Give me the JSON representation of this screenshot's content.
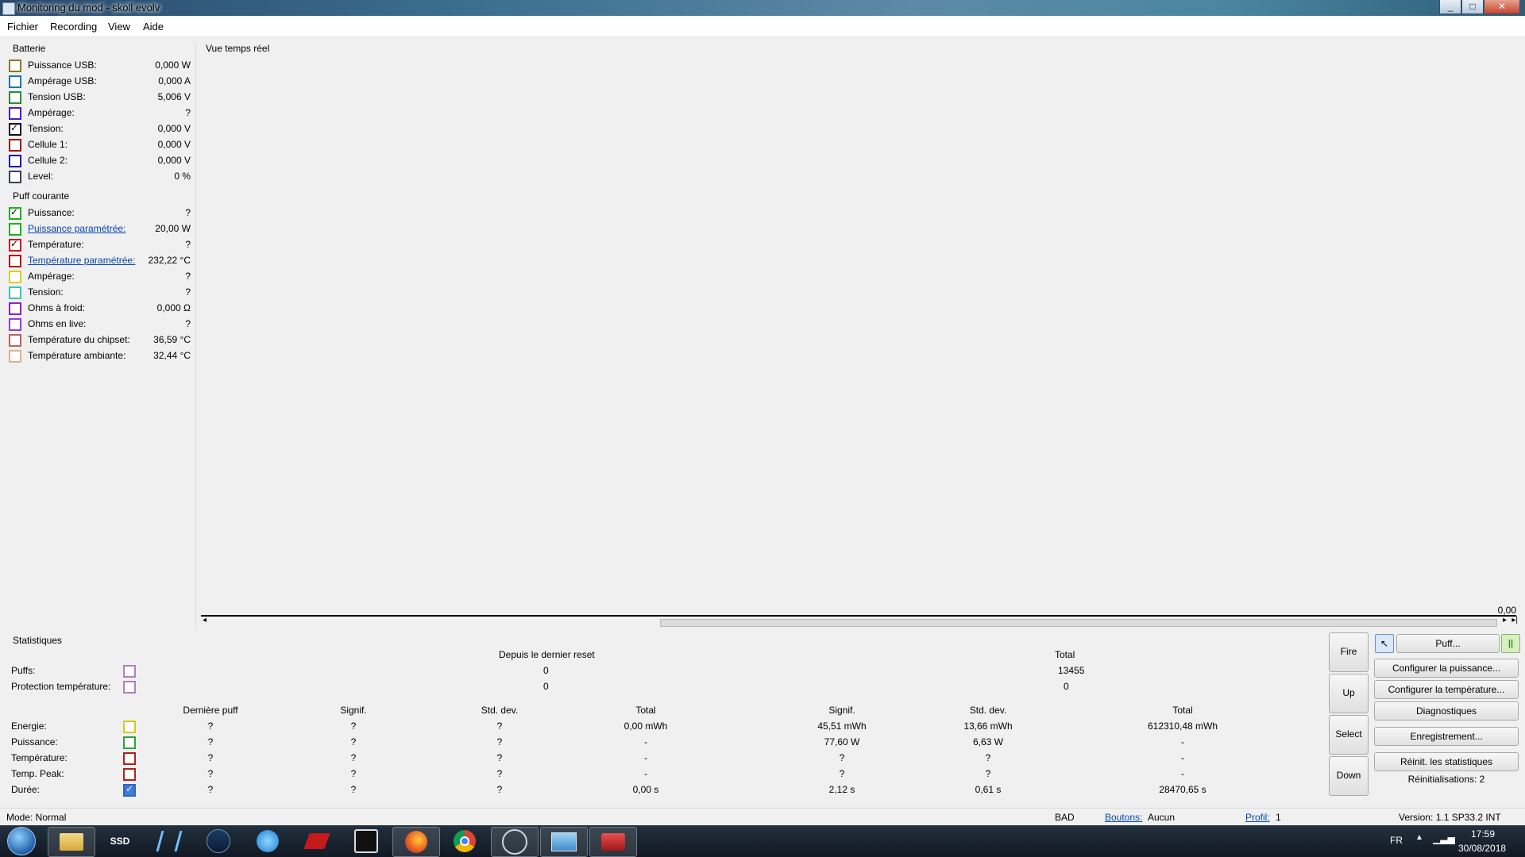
{
  "window": {
    "title": "Monitoring du mod - skoll evolv"
  },
  "menu": [
    "Fichier",
    "Recording",
    "View",
    "Aide"
  ],
  "battery": {
    "title": "Batterie",
    "items": [
      {
        "label": "Puissance USB:",
        "value": "0,000 W",
        "color": "#8c7a1e",
        "checked": false
      },
      {
        "label": "Ampérage USB:",
        "value": "0,000 A",
        "color": "#1e78a5",
        "checked": false
      },
      {
        "label": "Tension USB:",
        "value": "5,006 V",
        "color": "#2c8a40",
        "checked": false
      },
      {
        "label": "Ampérage:",
        "value": "?",
        "color": "#4a1dc8",
        "checked": false
      },
      {
        "label": "Tension:",
        "value": "0,000 V",
        "color": "#111111",
        "checked": true
      },
      {
        "label": "Cellule 1:",
        "value": "0,000 V",
        "color": "#a01818",
        "checked": false
      },
      {
        "label": "Cellule 2:",
        "value": "0,000 V",
        "color": "#1a1aa8",
        "checked": false
      },
      {
        "label": "Level:",
        "value": "0 %",
        "color": "#384650",
        "checked": false
      }
    ]
  },
  "puff": {
    "title": "Puff courante",
    "items": [
      {
        "label": "Puissance:",
        "value": "?",
        "color": "#20b020",
        "checked": true,
        "link": false
      },
      {
        "label": "Puissance paramétrée:",
        "value": "20,00 W",
        "color": "#20b020",
        "checked": false,
        "link": true
      },
      {
        "label": "Température:",
        "value": "?",
        "color": "#d01818",
        "checked": true,
        "link": false
      },
      {
        "label": "Température paramétrée:",
        "value": "232,22 °C",
        "color": "#b01818",
        "checked": false,
        "link": true
      },
      {
        "label": "Ampérage:",
        "value": "?",
        "color": "#d8d020",
        "checked": false,
        "link": false
      },
      {
        "label": "Tension:",
        "value": "?",
        "color": "#40c0c0",
        "checked": false,
        "link": false
      },
      {
        "label": "Ohms à froid:",
        "value": "0,000 Ω",
        "color": "#9020c0",
        "checked": false,
        "link": false
      },
      {
        "label": "Ohms en live:",
        "value": "?",
        "color": "#9040d0",
        "checked": false,
        "link": false
      },
      {
        "label": "Température du chipset:",
        "value": "36,59 °C",
        "color": "#c06060",
        "checked": false,
        "link": false
      },
      {
        "label": "Température ambiante:",
        "value": "32,44 °C",
        "color": "#e0b090",
        "checked": false,
        "link": false
      }
    ]
  },
  "chart": {
    "title": "Vue temps réel",
    "axis_value": "0,00"
  },
  "stats": {
    "title": "Statistiques",
    "header_reset": "Depuis le dernier reset",
    "header_total": "Total",
    "puffs_label": "Puffs:",
    "puffs_reset": "0",
    "puffs_total": "13455",
    "protection_label": "Protection température:",
    "protection_reset": "0",
    "protection_total": "0",
    "col_headers": [
      "Dernière puff",
      "Signif.",
      "Std. dev.",
      "Total",
      "Signif.",
      "Std. dev.",
      "Total"
    ],
    "rows": [
      {
        "label": "Energie:",
        "color": "#d8c820",
        "checked": false,
        "values": [
          "?",
          "?",
          "?",
          "0,00 mWh",
          "45,51 mWh",
          "13,66 mWh",
          "612310,48 mWh"
        ]
      },
      {
        "label": "Puissance:",
        "color": "#30a040",
        "checked": false,
        "values": [
          "?",
          "?",
          "?",
          "-",
          "77,60 W",
          "6,63 W",
          "-"
        ]
      },
      {
        "label": "Température:",
        "color": "#b02020",
        "checked": false,
        "values": [
          "?",
          "?",
          "?",
          "-",
          "?",
          "?",
          "-"
        ]
      },
      {
        "label": "Temp. Peak:",
        "color": "#b02020",
        "checked": false,
        "values": [
          "?",
          "?",
          "?",
          "-",
          "?",
          "?",
          "-"
        ]
      },
      {
        "label": "Durée:",
        "color": "#2e64c8",
        "checked": true,
        "values": [
          "?",
          "?",
          "?",
          "0,00 s",
          "2,12 s",
          "0,61 s",
          "28470,65 s"
        ]
      }
    ]
  },
  "side_buttons": [
    "Fire",
    "Up",
    "Select",
    "Down"
  ],
  "actions": {
    "puff": "Puff...",
    "configure_power": "Configurer la puissance...",
    "configure_temp": "Configurer la température...",
    "diagnostics": "Diagnostiques",
    "recording": "Enregistrement...",
    "reset_stats": "Réinit. les statistiques",
    "reset_count": "Réinitialisations: 2"
  },
  "status": {
    "mode": "Mode: Normal",
    "bad": "BAD",
    "buttons_label": "Boutons:",
    "buttons_value": "Aucun",
    "profile_label": "Profil:",
    "profile_value": "1",
    "version": "Version: 1.1 SP33.2 INT"
  },
  "taskbar": {
    "items": [
      "start",
      "explorer",
      "SSD",
      "atom",
      "steam",
      "arrow",
      "red-app",
      "eye",
      "firefox",
      "chrome",
      "atom2",
      "monitor",
      "toolbox"
    ],
    "lang": "FR",
    "time": "17:59",
    "date": "30/08/2018"
  }
}
